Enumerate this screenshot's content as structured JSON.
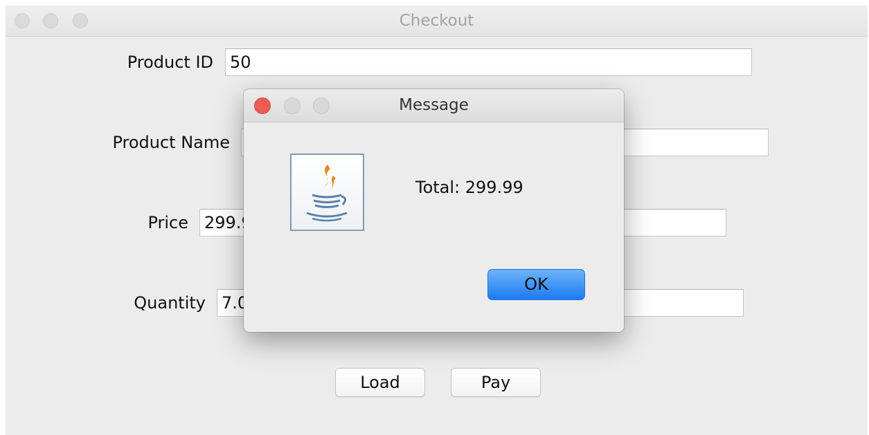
{
  "window": {
    "title": "Checkout"
  },
  "form": {
    "product_id": {
      "label": "Product ID",
      "value": "50"
    },
    "product_name": {
      "label": "Product Name",
      "value": ""
    },
    "price": {
      "label": "Price",
      "value": "299.99"
    },
    "quantity": {
      "label": "Quantity",
      "value": "7.0"
    }
  },
  "buttons": {
    "load": "Load",
    "pay": "Pay"
  },
  "dialog": {
    "title": "Message",
    "icon": "java-coffee-cup-icon",
    "message": "Total: 299.99",
    "ok_label": "OK"
  },
  "colors": {
    "close_red": "#ee5c56",
    "ok_blue": "#1d7af2",
    "java_orange": "#e8871e",
    "java_blue": "#5b82a8"
  }
}
